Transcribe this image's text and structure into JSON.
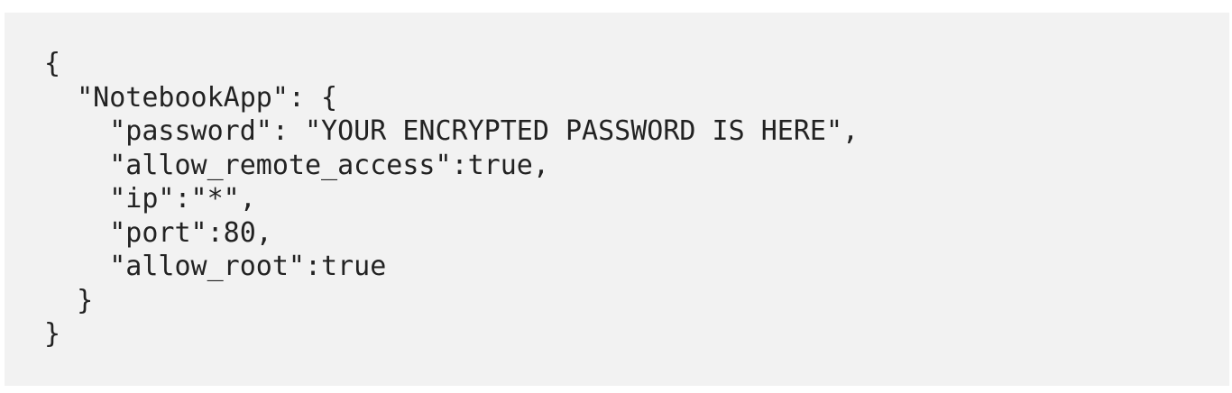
{
  "code": {
    "lines": [
      "{",
      "  \"NotebookApp\": {",
      "    \"password\": \"YOUR ENCRYPTED PASSWORD IS HERE\",",
      "    \"allow_remote_access\":true,",
      "    \"ip\":\"*\",",
      "    \"port\":80,",
      "    \"allow_root\":true",
      "  }",
      "}"
    ]
  }
}
